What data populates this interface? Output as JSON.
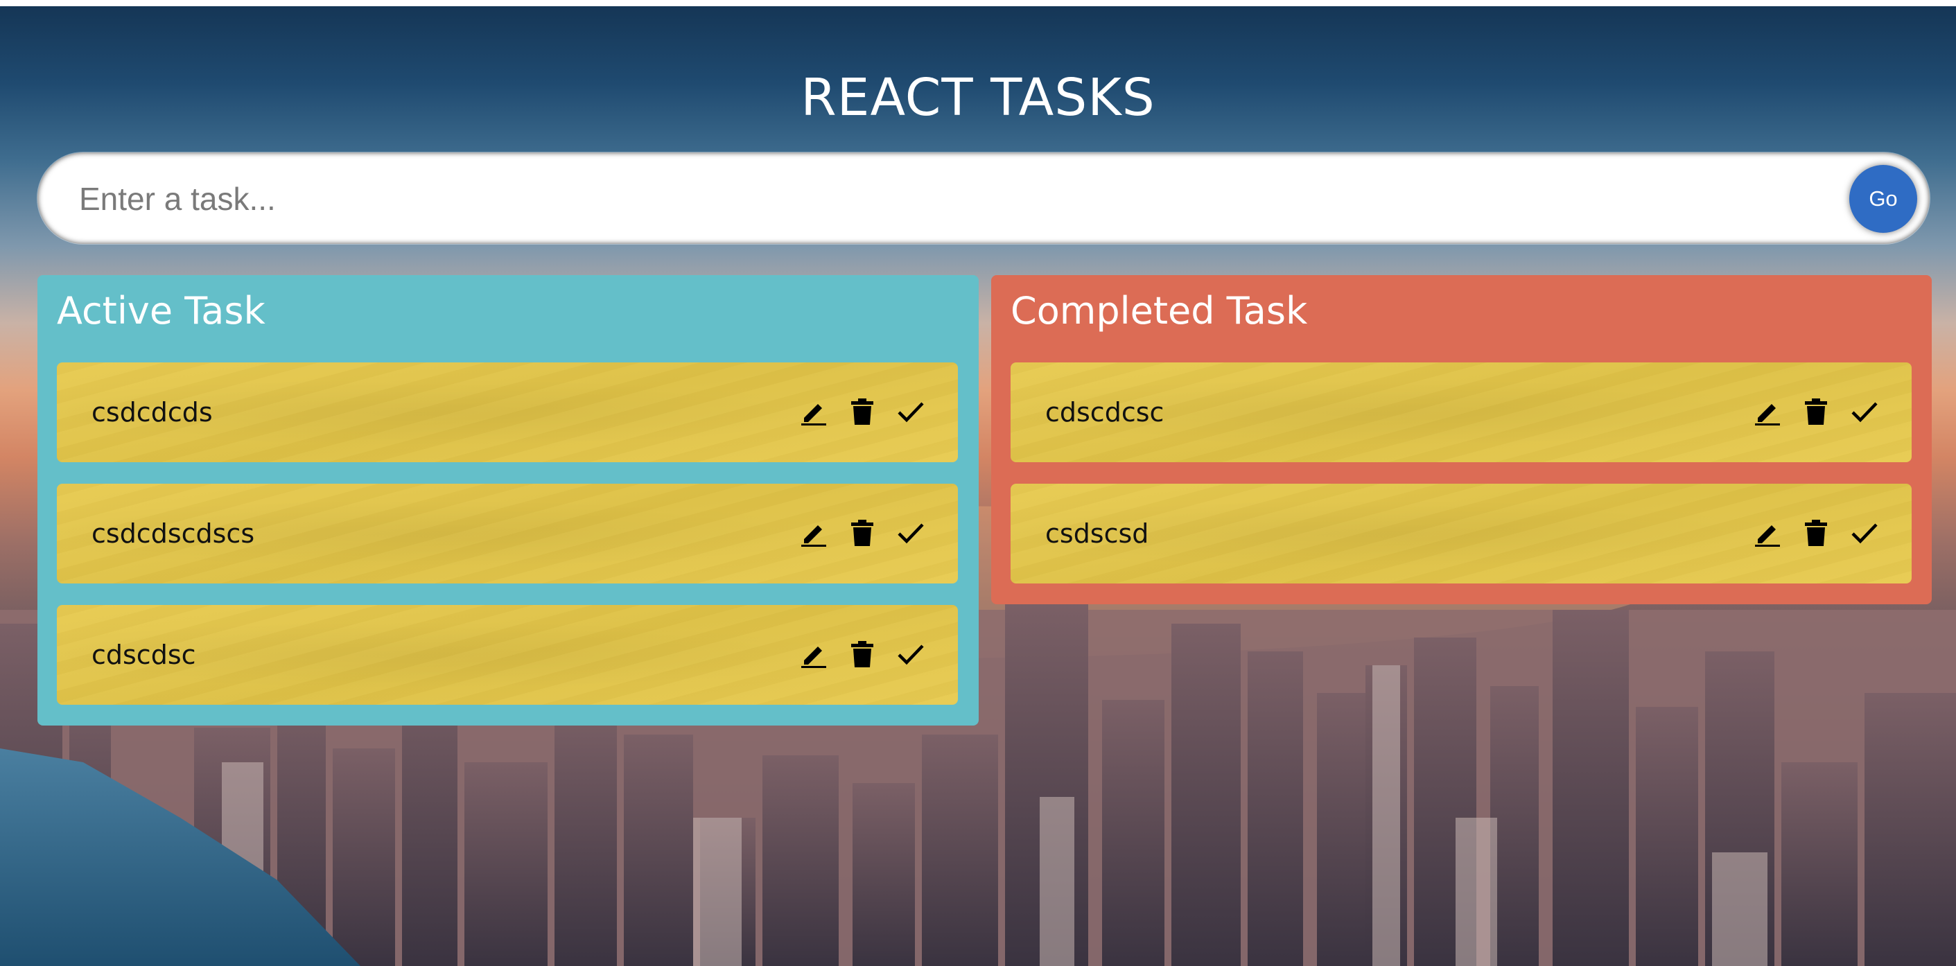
{
  "app": {
    "title": "REACT TASKS"
  },
  "input": {
    "placeholder": "Enter a task...",
    "value": "",
    "go_label": "Go"
  },
  "active": {
    "heading": "Active Task",
    "tasks": [
      {
        "text": "csdcdcds"
      },
      {
        "text": "csdcdscdscs"
      },
      {
        "text": "cdscdsc"
      }
    ]
  },
  "completed": {
    "heading": "Completed Task",
    "tasks": [
      {
        "text": "cdscdcsc"
      },
      {
        "text": "csdscsd"
      }
    ]
  },
  "icons": {
    "edit": "pencil-icon",
    "delete": "trash-icon",
    "done": "check-icon"
  },
  "colors": {
    "active_panel": "#64bfc9",
    "completed_panel": "#dc6c55",
    "task_card": "#e6c84a",
    "go_button": "#2f6cc4"
  }
}
